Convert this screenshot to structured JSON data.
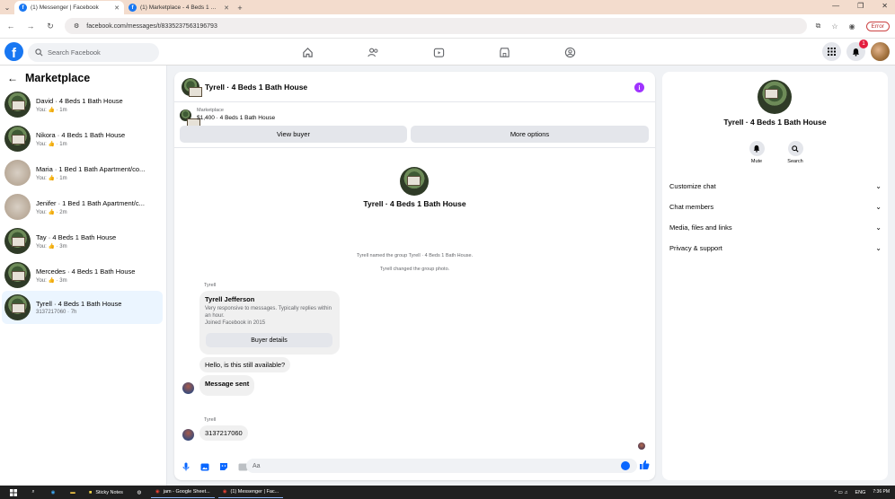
{
  "browser": {
    "tabs": [
      {
        "label": "(1) Messenger | Facebook",
        "active": true
      },
      {
        "label": "(1) Marketplace - 4 Beds 1 Bath",
        "active": false
      }
    ],
    "url": "facebook.com/messages/t/8335237563196793",
    "error_label": "Error"
  },
  "header": {
    "logo": "f",
    "search_placeholder": "Search Facebook",
    "notification_count": "1"
  },
  "sidebar": {
    "title": "Marketplace",
    "conversations": [
      {
        "name": "David · 4 Beds 1 Bath House",
        "you": "You:",
        "time": "· 1m",
        "thumb": "house"
      },
      {
        "name": "Nikora · 4 Beds 1 Bath House",
        "you": "You:",
        "time": "· 1m",
        "thumb": "house"
      },
      {
        "name": "Maria · 1 Bed 1 Bath Apartment/co...",
        "you": "You:",
        "time": "· 1m",
        "thumb": "room"
      },
      {
        "name": "Jenifer · 1 Bed 1 Bath Apartment/c...",
        "you": "You:",
        "time": "· 2m",
        "thumb": "room"
      },
      {
        "name": "Tay · 4 Beds 1 Bath House",
        "you": "You:",
        "time": "· 3m",
        "thumb": "house"
      },
      {
        "name": "Mercedes · 4 Beds 1 Bath House",
        "you": "You:",
        "time": "· 3m",
        "thumb": "house"
      },
      {
        "name": "Tyrell · 4 Beds 1 Bath House",
        "sub": "3137217060 · 7h",
        "thumb": "house",
        "active": true
      }
    ]
  },
  "chat": {
    "title": "Tyrell · 4 Beds 1 Bath House",
    "listing_source": "Marketplace",
    "listing_desc": "$1,400 · 4 Beds 1 Bath House",
    "view_buyer": "View buyer",
    "more_options": "More options",
    "thread_title": "Tyrell · 4 Beds 1 Bath House",
    "system_messages": [
      "Tyrell named the group Tyrell · 4 Beds 1 Bath House.",
      "Tyrell changed the group photo."
    ],
    "sender1": "Tyrell",
    "card_name": "Tyrell Jefferson",
    "card_desc": "Very responsive to messages. Typically replies within an hour.",
    "card_joined": "Joined Facebook in 2015",
    "card_button": "Buyer details",
    "msg1": "Hello, is this still available?",
    "msg2": "Message sent",
    "sender2": "Tyrell",
    "msg3": "3137217060",
    "composer_placeholder": "Aa"
  },
  "details": {
    "title": "Tyrell · 4 Beds 1 Bath House",
    "mute": "Mute",
    "search": "Search",
    "sections": [
      "Customize chat",
      "Chat members",
      "Media, files and links",
      "Privacy & support"
    ]
  },
  "taskbar": {
    "apps": [
      "Sticky Notes",
      "jam - Google Sheet...",
      "(1) Messenger | Fac..."
    ],
    "lang": "ENG",
    "time": "7:36 PM"
  },
  "colors": {
    "fb_blue": "#1877f2",
    "messenger_blue": "#0866ff",
    "accent_purple": "#a033ff",
    "badge_red": "#e41e3f"
  }
}
